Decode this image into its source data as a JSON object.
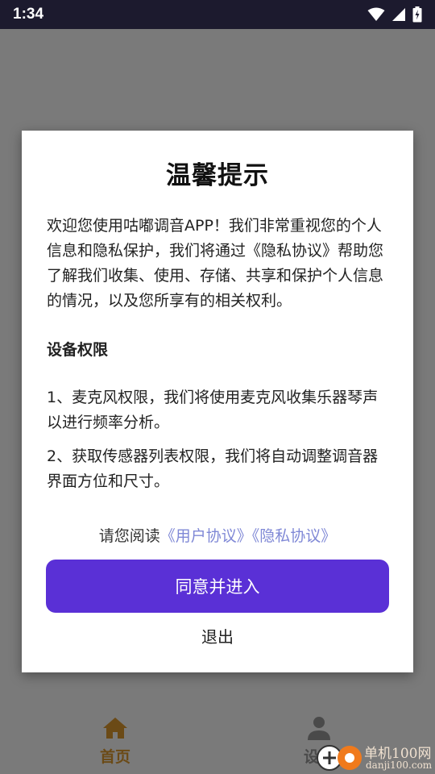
{
  "status_bar": {
    "time": "1:34"
  },
  "dialog": {
    "title": "温馨提示",
    "intro": "欢迎您使用咕嘟调音APP！我们非常重视您的个人信息和隐私保护，我们将通过《隐私协议》帮助您了解我们收集、使用、存储、共享和保护个人信息的情况，以及您所享有的相关权利。",
    "section_heading": "设备权限",
    "permission_1": "1、麦克风权限，我们将使用麦克风收集乐器琴声以进行频率分析。",
    "permission_2": "2、获取传感器列表权限，我们将自动调整调音器界面方位和尺寸。",
    "read_prefix": "请您阅读",
    "user_agreement_link": "《用户协议》",
    "privacy_link": "《隐私协议》",
    "agree_button": "同意并进入",
    "exit_button": "退出"
  },
  "bottom_nav": {
    "items": [
      {
        "label": "首页",
        "icon": "home-icon"
      },
      {
        "label": "设置",
        "icon": "person-icon"
      }
    ]
  },
  "watermark": {
    "text": "单机100网",
    "url": "danji100.com"
  },
  "colors": {
    "accent": "#5a30d6",
    "link": "#7f88d6",
    "status_bar": "#1c1a2e"
  }
}
